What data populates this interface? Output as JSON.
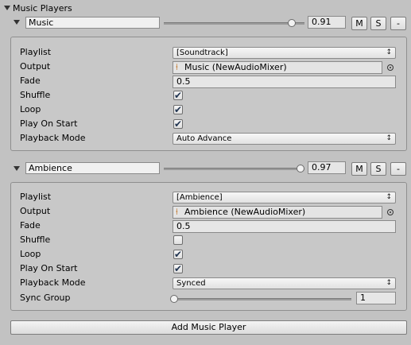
{
  "section_title": "Music Players",
  "players": [
    {
      "name": "Music",
      "volume_value": 0.91,
      "volume_text": "0.91",
      "mute_label": "M",
      "solo_label": "S",
      "remove_label": "-",
      "fields": {
        "playlist_label": "Playlist",
        "playlist_value": "[Soundtrack]",
        "output_label": "Output",
        "output_value": "Music (NewAudioMixer)",
        "fade_label": "Fade",
        "fade_value": "0.5",
        "shuffle_label": "Shuffle",
        "shuffle_checked": true,
        "loop_label": "Loop",
        "loop_checked": true,
        "play_on_start_label": "Play On Start",
        "play_on_start_checked": true,
        "playback_mode_label": "Playback Mode",
        "playback_mode_value": "Auto Advance"
      }
    },
    {
      "name": "Ambience",
      "volume_value": 0.97,
      "volume_text": "0.97",
      "mute_label": "M",
      "solo_label": "S",
      "remove_label": "-",
      "fields": {
        "playlist_label": "Playlist",
        "playlist_value": "[Ambience]",
        "output_label": "Output",
        "output_value": "Ambience (NewAudioMixer)",
        "fade_label": "Fade",
        "fade_value": "0.5",
        "shuffle_label": "Shuffle",
        "shuffle_checked": false,
        "loop_label": "Loop",
        "loop_checked": true,
        "play_on_start_label": "Play On Start",
        "play_on_start_checked": true,
        "playback_mode_label": "Playback Mode",
        "playback_mode_value": "Synced",
        "sync_group_label": "Sync Group",
        "sync_group_value": 1,
        "sync_group_text": "1"
      }
    }
  ],
  "add_button_label": "Add Music Player",
  "icons": {
    "foldout": "triangle-down",
    "dropdown": "updown-arrows",
    "mixer": "audio-mixer-icon",
    "picker": "object-picker-icon",
    "check": "checkmark"
  },
  "colors": {
    "background": "#c2c2c2",
    "panel": "#c8c8c8",
    "checkmark": "#1f3350",
    "mixer_icon": "#c07020"
  }
}
